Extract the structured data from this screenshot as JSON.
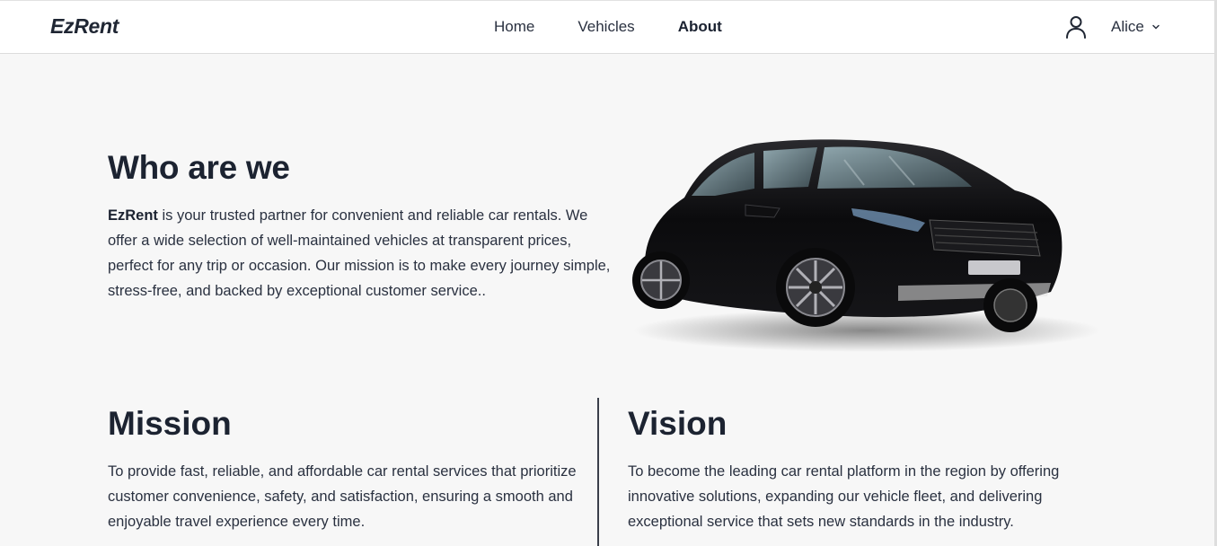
{
  "header": {
    "brand": "EzRent",
    "nav": [
      {
        "label": "Home",
        "active": false
      },
      {
        "label": "Vehicles",
        "active": false
      },
      {
        "label": "About",
        "active": true
      }
    ],
    "user": {
      "name": "Alice",
      "icon": "user-icon",
      "dropdown_icon": "chevron-down-icon"
    }
  },
  "about": {
    "title": "Who are we",
    "brand_name": "EzRent",
    "text": " is your trusted partner for convenient and reliable car rentals. We offer a wide selection of well-maintained vehicles at transparent prices, perfect for any trip or occasion. Our mission is to make every journey simple, stress-free, and backed by exceptional customer service.."
  },
  "mission": {
    "title": "Mission",
    "text": "To provide fast, reliable, and affordable car rental services that prioritize customer convenience, safety, and satisfaction, ensuring a smooth and enjoyable travel experience every time."
  },
  "vision": {
    "title": "Vision",
    "text": "To become the leading car rental platform in the region by offering innovative solutions, expanding our vehicle fleet, and delivering exceptional service that sets new standards in the industry."
  },
  "colors": {
    "background": "#f7f7f7",
    "header_bg": "#ffffff",
    "text_dark": "#1c2331",
    "car_body": "#0d0d0f"
  }
}
